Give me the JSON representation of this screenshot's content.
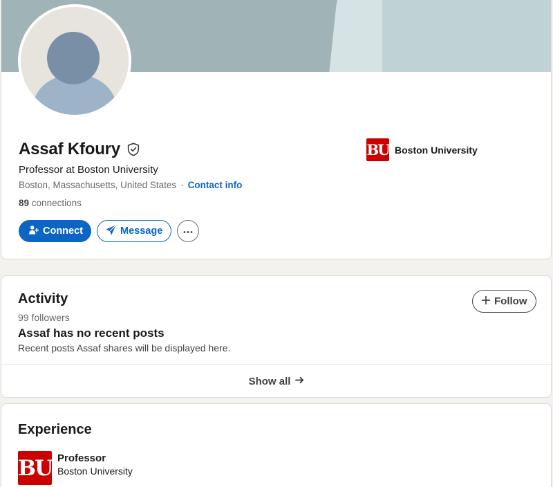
{
  "profile": {
    "name": "Assaf Kfoury",
    "headline": "Professor at Boston University",
    "location": "Boston, Massachusetts, United States",
    "separator": "·",
    "contact_info_label": "Contact info",
    "connections_count": "89",
    "connections_label": "connections",
    "company": "Boston University",
    "company_logo_text": "BU"
  },
  "actions": {
    "connect_label": "Connect",
    "message_label": "Message",
    "more_icon": "more-horizontal-icon"
  },
  "activity": {
    "title": "Activity",
    "followers": "99 followers",
    "follow_label": "Follow",
    "no_posts_title": "Assaf has no recent posts",
    "no_posts_sub": "Recent posts Assaf shares will be displayed here.",
    "show_all_label": "Show all"
  },
  "experience": {
    "title": "Experience",
    "items": [
      {
        "title": "Professor",
        "company": "Boston University",
        "logo_text": "BU"
      }
    ]
  },
  "colors": {
    "accent": "#0a66c2",
    "bu_red": "#cc0000",
    "banner": "#a0b4b7",
    "page_bg": "#f4f2ee"
  }
}
